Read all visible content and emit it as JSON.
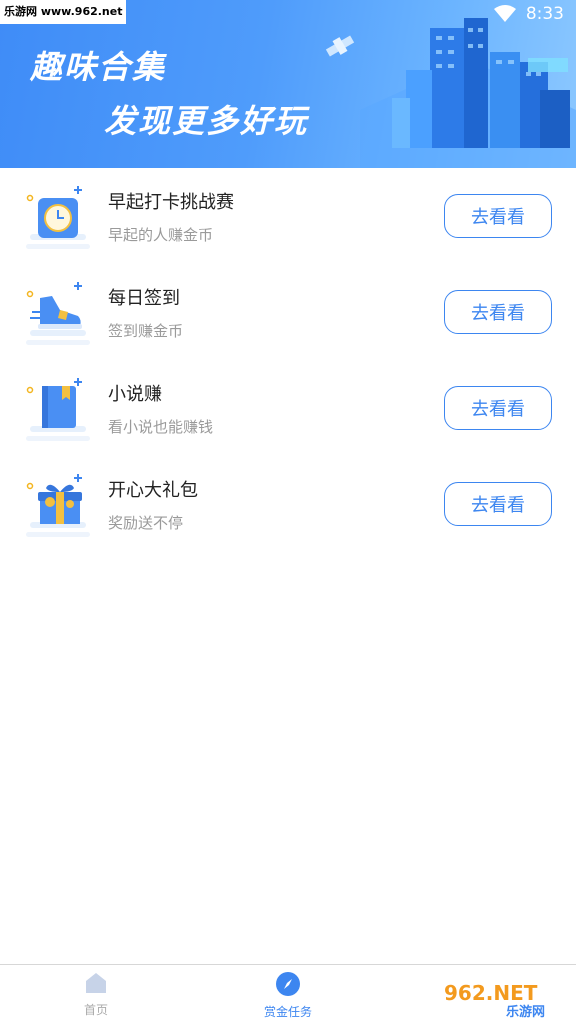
{
  "status_bar": {
    "watermark": "乐游网 www.962.net",
    "time": "8:33"
  },
  "banner": {
    "title": "趣味合集",
    "subtitle": "发现更多好玩"
  },
  "tasks": [
    {
      "title": "早起打卡挑战赛",
      "subtitle": "早起的人赚金币",
      "button": "去看看",
      "icon": "clock-icon"
    },
    {
      "title": "每日签到",
      "subtitle": "签到赚金币",
      "button": "去看看",
      "icon": "sneaker-icon"
    },
    {
      "title": "小说赚",
      "subtitle": "看小说也能赚钱",
      "button": "去看看",
      "icon": "book-icon"
    },
    {
      "title": "开心大礼包",
      "subtitle": "奖励送不停",
      "button": "去看看",
      "icon": "gift-icon"
    }
  ],
  "tabbar": {
    "items": [
      {
        "label": "首页",
        "icon": "home-icon",
        "active": false
      },
      {
        "label": "赏金任务",
        "icon": "compass-icon",
        "active": true
      }
    ]
  },
  "watermark_bottom": {
    "brand": "962.NET",
    "name": "乐游网"
  },
  "colors": {
    "accent": "#3d86f0",
    "banner": "#4f9cfb",
    "subtitle": "#9a9a9a"
  }
}
